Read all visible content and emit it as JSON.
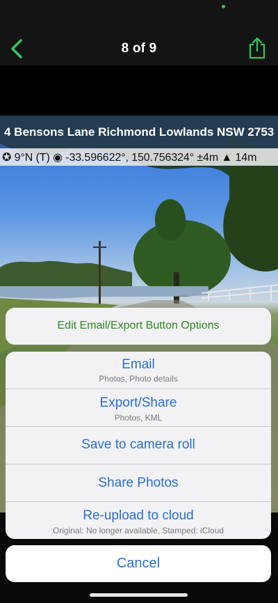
{
  "nav": {
    "title": "8 of 9",
    "back_icon": "chevron-left-icon",
    "share_icon": "share-icon",
    "accent_color": "#35c759"
  },
  "photo": {
    "address": "4 Bensons Lane Richmond Lowlands NSW 2753",
    "coordinates": "✪ 9°N (T)  ◉ -33.596622°, 150.756324° ±4m  ▲ 14m"
  },
  "sheet": {
    "edit_options_label": "Edit Email/Export Button Options",
    "actions": [
      {
        "label": "Email",
        "sub": "Photos, Photo details"
      },
      {
        "label": "Export/Share",
        "sub": "Photos, KML"
      },
      {
        "label": "Save to camera roll",
        "sub": ""
      },
      {
        "label": "Share Photos",
        "sub": ""
      },
      {
        "label": "Re-upload to cloud",
        "sub": "Original: No longer available, Stamped: iCloud"
      }
    ],
    "cancel_label": "Cancel",
    "action_color": "#2a6fd0",
    "edit_color": "#2e8a1e"
  }
}
